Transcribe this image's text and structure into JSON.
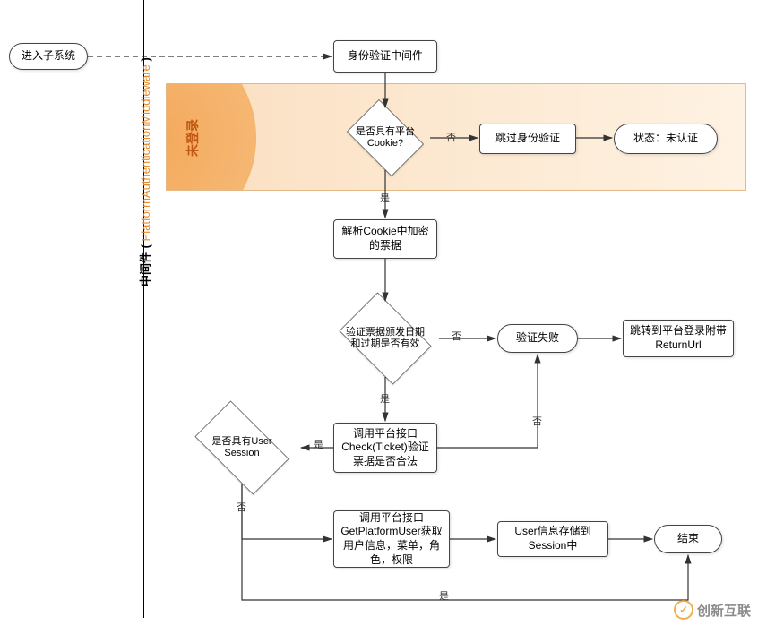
{
  "swimlane": {
    "title_prefix": "中间件 ( ",
    "title_class": "PlatformAuthenticationMiddleware",
    "title_suffix": " )"
  },
  "region": {
    "label": "未登录"
  },
  "nodes": {
    "enter_subsystem": "进入子系统",
    "auth_middleware": "身份验证中间件",
    "has_platform_cookie": "是否具有平台Cookie?",
    "skip_auth": "跳过身份验证",
    "state_unauth": "状态：未认证",
    "parse_cookie_ticket": "解析Cookie中加密的票据",
    "validate_ticket_dates": "验证票据颁发日期和过期是否有效",
    "verify_fail": "验证失败",
    "redirect_login": "跳转到平台登录附带ReturnUrl",
    "check_ticket": "调用平台接口Check(Ticket)验证票据是否合法",
    "has_user_session": "是否具有User Session",
    "get_platform_user": "调用平台接口GetPlatformUser获取用户信息，菜单，角色，权限",
    "save_session": "User信息存储到Session中",
    "end": "结束"
  },
  "edges": {
    "yes": "是",
    "no": "否"
  },
  "watermark": {
    "text": "创新互联",
    "icon": "✓"
  }
}
